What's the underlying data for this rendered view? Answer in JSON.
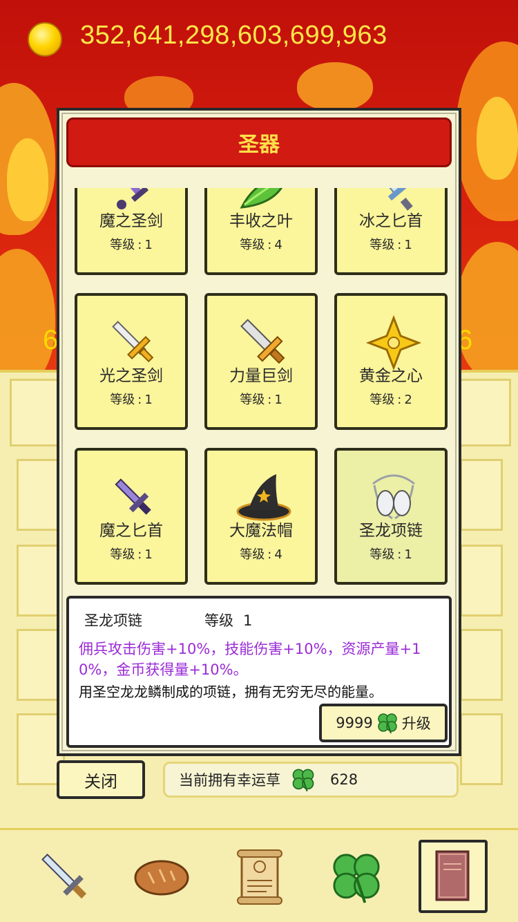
{
  "gold": {
    "amount": "352,641,298,603,699,963"
  },
  "modal": {
    "title": "圣器",
    "level_label": "等级",
    "level_sep": ":",
    "items": [
      {
        "name": "魔之圣剑",
        "level": "1",
        "icon": "dark-sword-icon"
      },
      {
        "name": "丰收之叶",
        "level": "4",
        "icon": "leaf-icon"
      },
      {
        "name": "冰之匕首",
        "level": "1",
        "icon": "ice-dagger-icon"
      },
      {
        "name": "光之圣剑",
        "level": "1",
        "icon": "light-sword-icon"
      },
      {
        "name": "力量巨剑",
        "level": "1",
        "icon": "great-sword-icon"
      },
      {
        "name": "黄金之心",
        "level": "2",
        "icon": "golden-heart-icon"
      },
      {
        "name": "魔之匕首",
        "level": "1",
        "icon": "dark-dagger-icon"
      },
      {
        "name": "大魔法帽",
        "level": "4",
        "icon": "wizard-hat-icon"
      },
      {
        "name": "圣龙项链",
        "level": "1",
        "icon": "necklace-icon",
        "selected": true
      }
    ],
    "detail": {
      "name": "圣龙项链",
      "level_label": "等级",
      "level_value": "1",
      "effect": "佣兵攻击伤害+10%，技能伤害+10%，资源产量+10%，金币获得量+10%。",
      "description": "用圣空龙龙鳞制成的项链，拥有无穷无尽的能量。",
      "upgrade_cost": "9999",
      "upgrade_label": "升级"
    },
    "close_label": "关闭",
    "clover_label": "当前拥有幸运草",
    "clover_count": "628"
  },
  "nav": [
    {
      "name": "nav-sword",
      "icon": "sword-icon"
    },
    {
      "name": "nav-bread",
      "icon": "bread-icon"
    },
    {
      "name": "nav-scroll",
      "icon": "scroll-icon"
    },
    {
      "name": "nav-clover",
      "icon": "clover-icon"
    },
    {
      "name": "nav-book",
      "icon": "book-icon",
      "active": true
    }
  ],
  "colors": {
    "header_red": "#d01a12",
    "title_yellow": "#ffe04a",
    "effect_purple": "#9a2bd6",
    "tile_yellow": "#fbf59b"
  }
}
